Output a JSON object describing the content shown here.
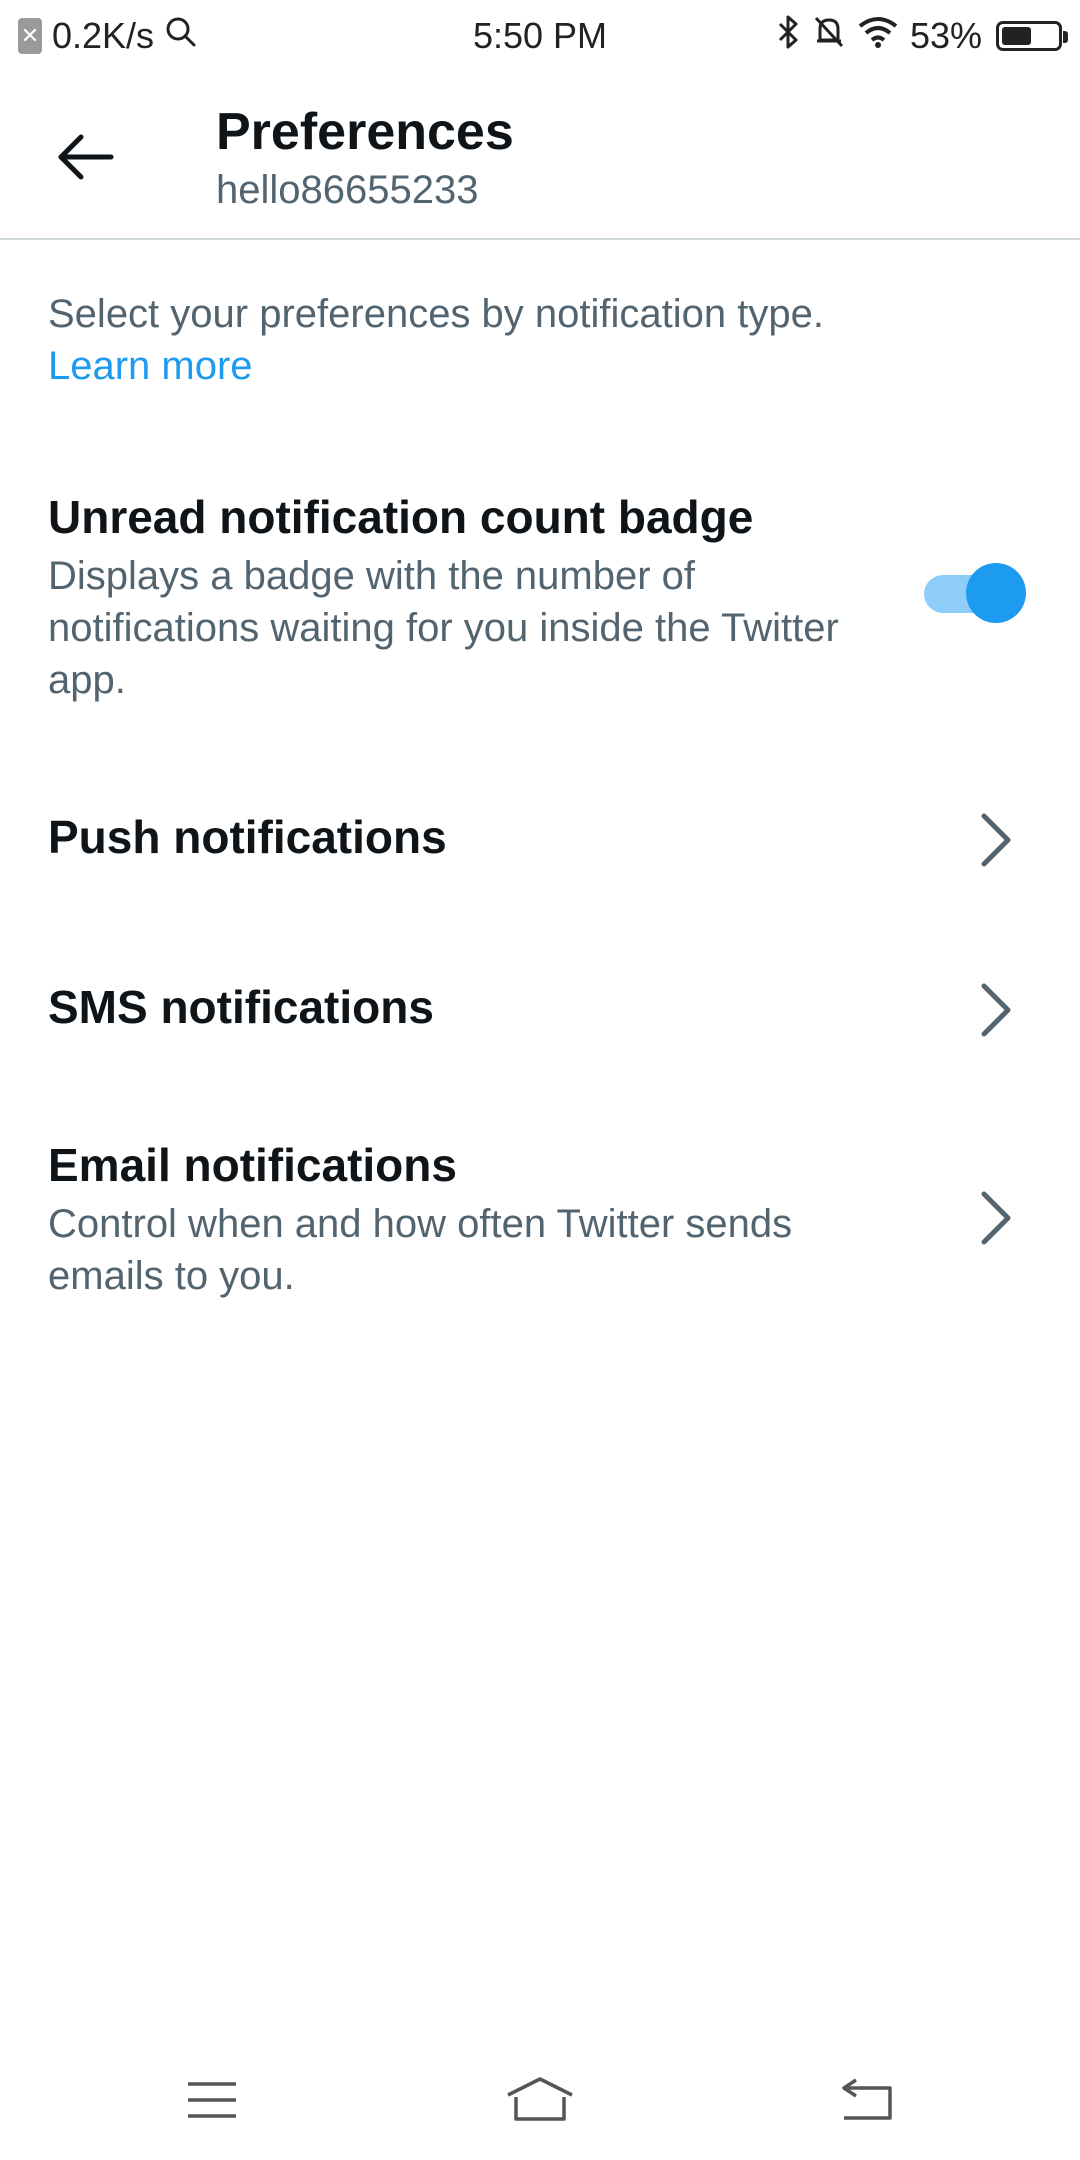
{
  "status_bar": {
    "network_speed": "0.2K/s",
    "time": "5:50 PM",
    "battery_percent": "53%",
    "battery_level": 0.53
  },
  "header": {
    "title": "Preferences",
    "username": "hello86655233"
  },
  "intro": {
    "text": "Select your preferences by notification type.",
    "link": "Learn more"
  },
  "settings": {
    "badge": {
      "title": "Unread notification count badge",
      "description": "Displays a badge with the number of notifications waiting for you inside the Twitter app.",
      "enabled": true
    },
    "push": {
      "title": "Push notifications"
    },
    "sms": {
      "title": "SMS notifications"
    },
    "email": {
      "title": "Email notifications",
      "description": "Control when and how often Twitter sends emails to you."
    }
  },
  "colors": {
    "accent": "#1d9bf0",
    "secondary_text": "#536471",
    "primary_text": "#0f1419"
  }
}
